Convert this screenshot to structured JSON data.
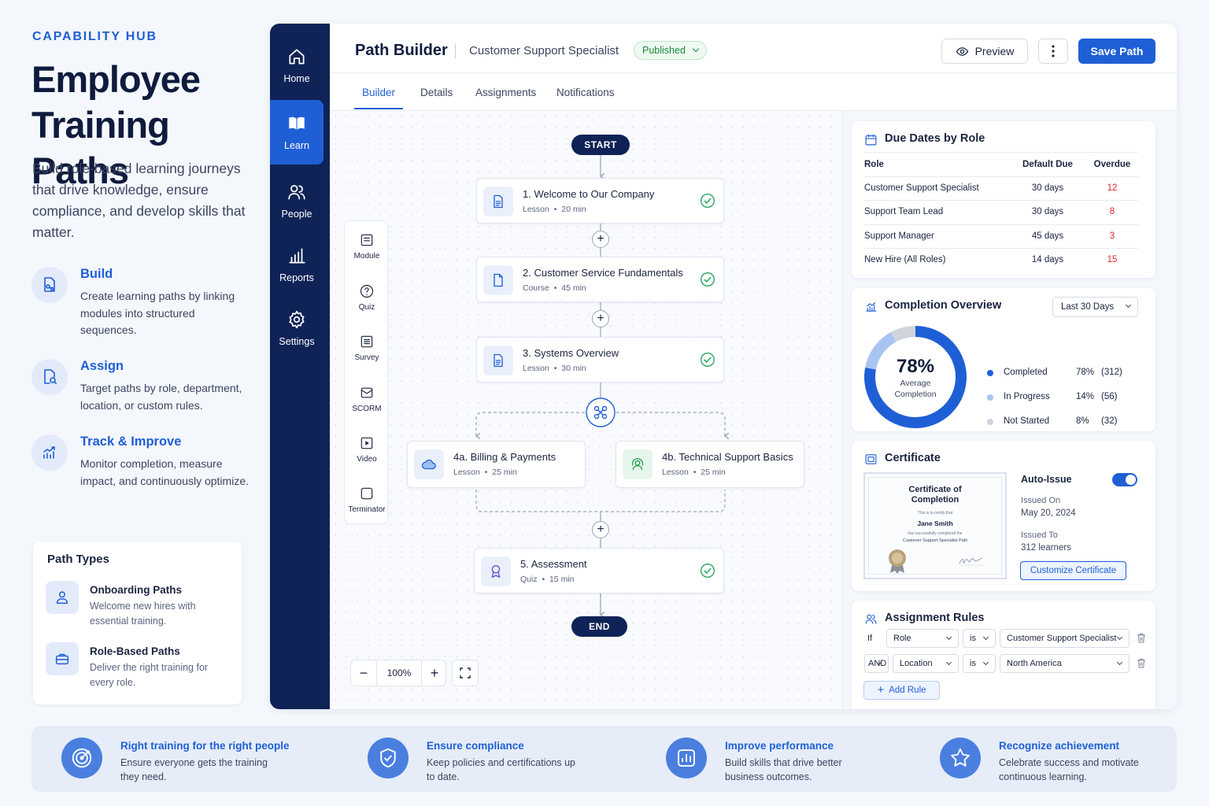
{
  "intro": {
    "eyebrow": "CAPABILITY HUB",
    "title": "Employee Training Paths",
    "description": "Build role-based learning journeys that drive knowledge, ensure compliance, and develop skills that matter.",
    "features": [
      {
        "title": "Build",
        "text": "Create learning paths by linking modules into structured sequences.",
        "icon": "build-icon"
      },
      {
        "title": "Assign",
        "text": "Target paths by role, department, location, or custom rules.",
        "icon": "assign-icon"
      },
      {
        "title": "Track & Improve",
        "text": "Monitor completion, measure impact, and continuously optimize.",
        "icon": "trend-icon"
      }
    ],
    "path_types": {
      "title": "Path Types",
      "items": [
        {
          "title": "Onboarding Paths",
          "text": "Welcome new hires with essential training.",
          "icon": "user-icon"
        },
        {
          "title": "Role-Based Paths",
          "text": "Deliver the right training for every role.",
          "icon": "briefcase-icon"
        }
      ]
    }
  },
  "sidebar": {
    "items": [
      {
        "label": "Home",
        "icon": "home-icon"
      },
      {
        "label": "Learn",
        "icon": "book-icon",
        "active": true
      },
      {
        "label": "People",
        "icon": "people-icon"
      },
      {
        "label": "Reports",
        "icon": "bar-chart-icon"
      },
      {
        "label": "Settings",
        "icon": "gear-icon"
      }
    ]
  },
  "header": {
    "title": "Path Builder",
    "path_name": "Customer Support Specialist",
    "status": "Published",
    "preview_label": "Preview",
    "save_label": "Save Path"
  },
  "tabs": [
    "Builder",
    "Details",
    "Assignments",
    "Notifications"
  ],
  "palette": [
    "Module",
    "Quiz",
    "Survey",
    "SCORM",
    "Video",
    "Terminator"
  ],
  "flow": {
    "start": "START",
    "end": "END",
    "nodes": [
      {
        "title": "1. Welcome to Our Company",
        "type": "Lesson",
        "duration": "20 min"
      },
      {
        "title": "2. Customer Service Fundamentals",
        "type": "Course",
        "duration": "45 min"
      },
      {
        "title": "3. Systems Overview",
        "type": "Lesson",
        "duration": "30 min"
      },
      {
        "title": "4a. Billing & Payments",
        "type": "Lesson",
        "duration": "25 min"
      },
      {
        "title": "4b. Technical Support Basics",
        "type": "Lesson",
        "duration": "25 min"
      },
      {
        "title": "5. Assessment",
        "type": "Quiz",
        "duration": "15 min"
      }
    ],
    "separator": "•",
    "zoom": "100%"
  },
  "due_dates": {
    "title": "Due Dates by Role",
    "headers": [
      "Role",
      "Default Due",
      "Overdue"
    ],
    "rows": [
      [
        "Customer Support Specialist",
        "30 days",
        "12"
      ],
      [
        "Support Team Lead",
        "30 days",
        "8"
      ],
      [
        "Support Manager",
        "45 days",
        "3"
      ],
      [
        "New Hire (All Roles)",
        "14 days",
        "15"
      ]
    ]
  },
  "completion": {
    "title": "Completion Overview",
    "range": "Last 30 Days",
    "percent": "78%",
    "caption": "Average Completion",
    "legend": [
      {
        "label": "Completed",
        "pct": "78%",
        "count": "(312)",
        "color": "#1f5fd6",
        "value": 78
      },
      {
        "label": "In Progress",
        "pct": "14%",
        "count": "(56)",
        "color": "#a9c4f2",
        "value": 14
      },
      {
        "label": "Not Started",
        "pct": "8%",
        "count": "(32)",
        "color": "#cfd4dc",
        "value": 8
      }
    ]
  },
  "certificate": {
    "title": "Certificate",
    "cert_title": "Certificate of Completion",
    "certify_line": "This is to certify that",
    "recipient": "Jane Smith",
    "completed_line": "has successfully completed the",
    "path_line": "Customer Support Specialist Path",
    "auto_issue_label": "Auto-Issue",
    "auto_issue": true,
    "issued_on_label": "Issued On",
    "issued_on": "May 20, 2024",
    "issued_to_label": "Issued To",
    "issued_to": "312 learners",
    "customize_label": "Customize Certificate"
  },
  "rules": {
    "title": "Assignment Rules",
    "rows": [
      {
        "conj": "If",
        "field": "Role",
        "op": "is",
        "value": "Customer Support Specialist"
      },
      {
        "conj": "AND",
        "field": "Location",
        "op": "is",
        "value": "North America"
      }
    ],
    "add_label": "Add Rule"
  },
  "benefits": [
    {
      "title": "Right training for the right people",
      "text": "Ensure everyone gets the training they need.",
      "icon": "target-icon"
    },
    {
      "title": "Ensure compliance",
      "text": "Keep policies and certifications up to date.",
      "icon": "shield-icon"
    },
    {
      "title": "Improve performance",
      "text": "Build skills that drive better business outcomes.",
      "icon": "bar-chart-icon"
    },
    {
      "title": "Recognize achievement",
      "text": "Celebrate success and motivate continuous learning.",
      "icon": "star-icon"
    }
  ]
}
